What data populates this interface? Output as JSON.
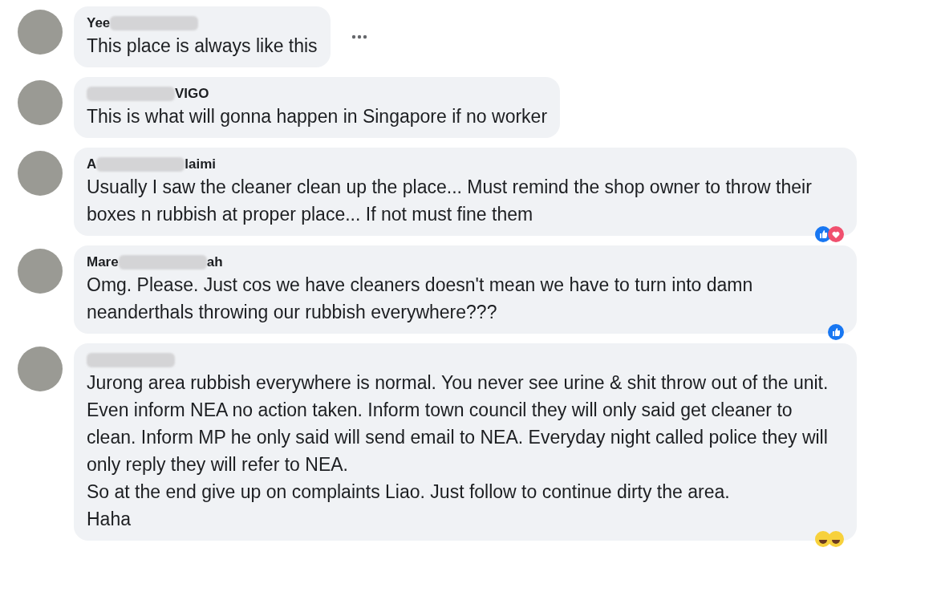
{
  "comments": [
    {
      "name_start": "Yee",
      "text": "This place is always like this",
      "has_menu": true
    },
    {
      "name_end": "VIGO",
      "text": "This is what will gonna happen in Singapore if no worker"
    },
    {
      "name_start": "A",
      "name_end": "laimi",
      "text": "Usually I saw the cleaner clean up the place... Must remind the shop owner to throw their boxes n rubbish at proper place... If not must fine them",
      "reactions": [
        {
          "kind": "like"
        },
        {
          "kind": "love"
        }
      ]
    },
    {
      "name_start": "Mare",
      "name_end": "ah",
      "text": "Omg. Please. Just cos we have cleaners doesn't mean we have to turn into damn neanderthals throwing our rubbish everywhere???",
      "reactions": [
        {
          "kind": "like"
        }
      ]
    },
    {
      "text": "Jurong area rubbish everywhere is normal. You never see urine & shit throw out of the unit. Even inform NEA no action taken. Inform town council they will only said get cleaner to clean. Inform MP he only said will send email to NEA. Everyday night called police they will only reply they will refer to NEA.\nSo at the end give up on complaints Liao. Just follow to continue dirty the area.\nHaha",
      "reactions": [
        {
          "kind": "haha"
        },
        {
          "kind": "haha"
        }
      ]
    }
  ]
}
